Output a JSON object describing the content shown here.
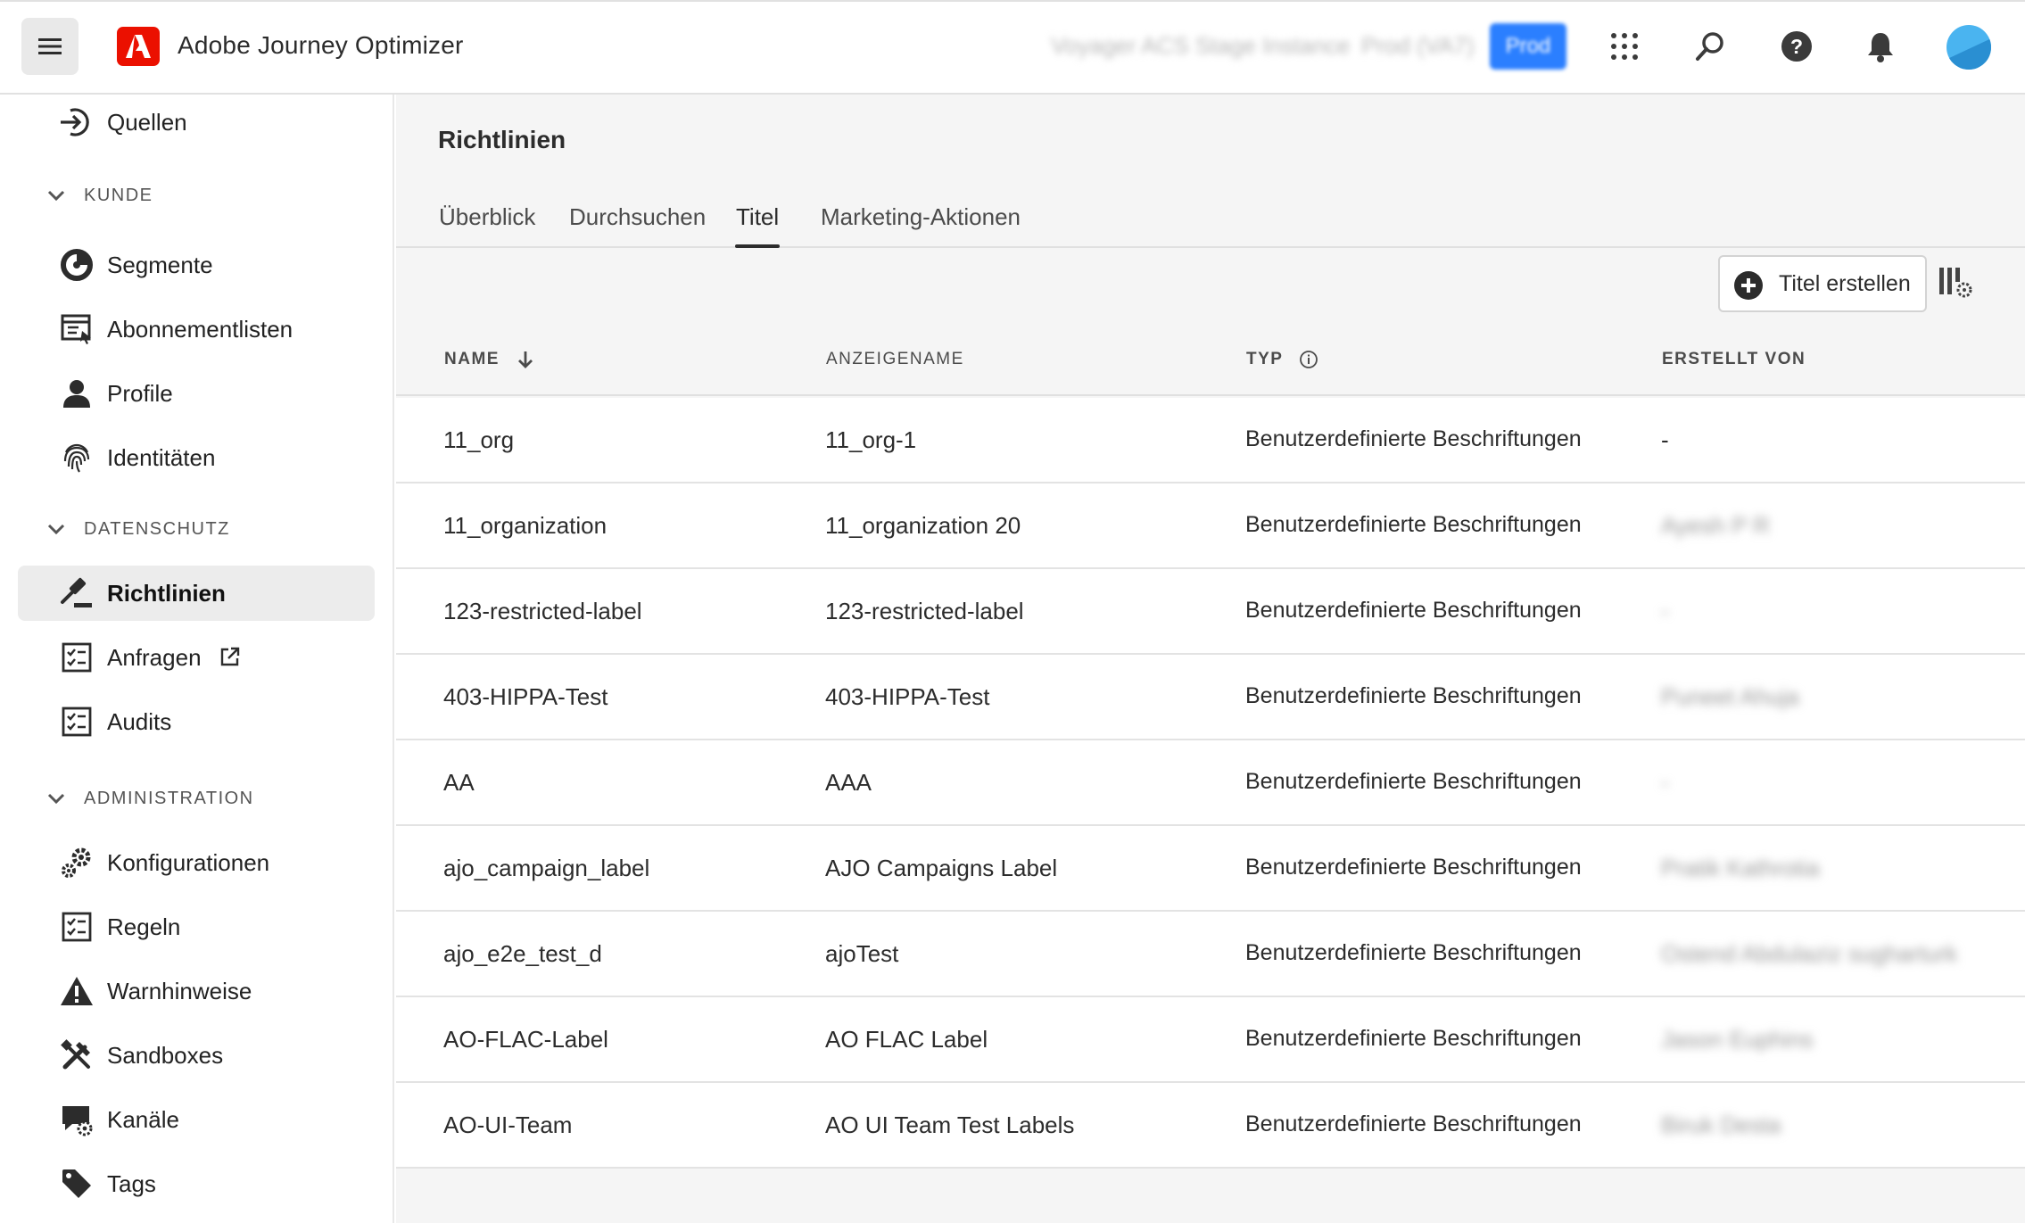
{
  "app": {
    "title": "Adobe Journey Optimizer",
    "org_name": "Voyager ACS Stage Instance",
    "env_name": "Prod (VA7)",
    "env_badge": "Prod"
  },
  "topbar_icons": [
    "menu-icon",
    "apps-grid-icon",
    "search-icon",
    "help-icon",
    "notifications-bell-icon",
    "avatar"
  ],
  "sidebar": {
    "items_top": [
      {
        "label": "Quellen",
        "icon": "arrow-into-icon"
      }
    ],
    "sections": [
      {
        "label": "KUNDE",
        "items": [
          {
            "label": "Segmente",
            "icon": "segments-icon"
          },
          {
            "label": "Abonnementlisten",
            "icon": "subscription-list-icon"
          },
          {
            "label": "Profile",
            "icon": "user-icon"
          },
          {
            "label": "Identitäten",
            "icon": "fingerprint-icon"
          }
        ]
      },
      {
        "label": "DATENSCHUTZ",
        "items": [
          {
            "label": "Richtlinien",
            "icon": "gavel-icon",
            "active": true
          },
          {
            "label": "Anfragen",
            "icon": "checklist-icon",
            "external": true
          },
          {
            "label": "Audits",
            "icon": "checklist-icon"
          }
        ]
      },
      {
        "label": "ADMINISTRATION",
        "items": [
          {
            "label": "Konfigurationen",
            "icon": "gears-icon"
          },
          {
            "label": "Regeln",
            "icon": "checklist-icon"
          },
          {
            "label": "Warnhinweise",
            "icon": "warning-icon"
          },
          {
            "label": "Sandboxes",
            "icon": "sandbox-tools-icon"
          },
          {
            "label": "Kanäle",
            "icon": "channels-icon"
          },
          {
            "label": "Tags",
            "icon": "tag-icon"
          }
        ]
      }
    ]
  },
  "main": {
    "title": "Richtlinien",
    "tabs": [
      {
        "label": "Überblick"
      },
      {
        "label": "Durchsuchen"
      },
      {
        "label": "Titel",
        "active": true
      },
      {
        "label": "Marketing-Aktionen"
      }
    ],
    "create_button": "Titel erstellen",
    "columns": [
      "NAME",
      "ANZEIGENAME",
      "TYP",
      "ERSTELLT VON"
    ],
    "sort": {
      "column": "NAME",
      "direction": "descending"
    },
    "rows": [
      {
        "name": "11_org",
        "display": "11_org-1",
        "type": "Benutzerdefinierte Beschriftungen",
        "created_by": "-"
      },
      {
        "name": "11_organization",
        "display": "11_organization 20",
        "type": "Benutzerdefinierte Beschriftungen",
        "created_by": "Ayesh P R",
        "blurred": true
      },
      {
        "name": "123-restricted-label",
        "display": "123-restricted-label",
        "type": "Benutzerdefinierte Beschriftungen",
        "created_by": "-",
        "blurred": true
      },
      {
        "name": "403-HIPPA-Test",
        "display": "403-HIPPA-Test",
        "type": "Benutzerdefinierte Beschriftungen",
        "created_by": "Puneet Ahuja",
        "blurred": true
      },
      {
        "name": "AA",
        "display": "AAA",
        "type": "Benutzerdefinierte Beschriftungen",
        "created_by": "-",
        "blurred": true
      },
      {
        "name": "ajo_campaign_label",
        "display": "AJO Campaigns Label",
        "type": "Benutzerdefinierte Beschriftungen",
        "created_by": "Pratik Kathrotia",
        "blurred": true
      },
      {
        "name": "ajo_e2e_test_d",
        "display": "ajoTest",
        "type": "Benutzerdefinierte Beschriftungen",
        "created_by": "Ostend Abdulaziz sugharturk",
        "blurred": true
      },
      {
        "name": "AO-FLAC-Label",
        "display": "AO FLAC Label",
        "type": "Benutzerdefinierte Beschriftungen",
        "created_by": "Jason Euphins",
        "blurred": true
      },
      {
        "name": "AO-UI-Team",
        "display": "AO UI Team Test Labels",
        "type": "Benutzerdefinierte Beschriftungen",
        "created_by": "Biruk Desta",
        "blurred": true
      }
    ]
  }
}
